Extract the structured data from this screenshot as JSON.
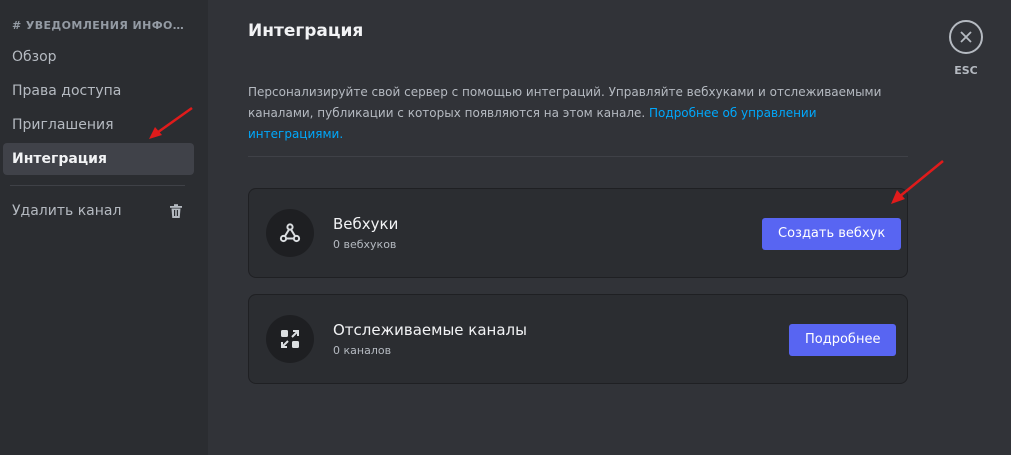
{
  "sidebar": {
    "header": "# УВЕДОМЛЕНИЯ ИНФОР...",
    "items": [
      {
        "label": "Обзор"
      },
      {
        "label": "Права доступа"
      },
      {
        "label": "Приглашения"
      },
      {
        "label": "Интеграция",
        "active": true
      },
      {
        "label": "Удалить канал"
      }
    ]
  },
  "main": {
    "title": "Интеграция",
    "description": "Персонализируйте свой сервер с помощью интеграций. Управляйте вебхуками и отслеживаемыми каналами, публикации с которых появляются на этом канале.",
    "description_link": "Подробнее об управлении интеграциями.",
    "cards": [
      {
        "title": "Вебхуки",
        "subtitle": "0 вебхуков",
        "button": "Создать вебхук",
        "icon": "webhook-icon"
      },
      {
        "title": "Отслеживаемые каналы",
        "subtitle": "0 каналов",
        "button": "Подробнее",
        "icon": "follow-channel-icon"
      }
    ]
  },
  "close": {
    "label": "ESC"
  },
  "colors": {
    "background": "#313338",
    "sidebar": "#2b2d31",
    "accent": "#5865f2",
    "link": "#00a8fc",
    "annotation_arrow": "#e01b1b"
  }
}
